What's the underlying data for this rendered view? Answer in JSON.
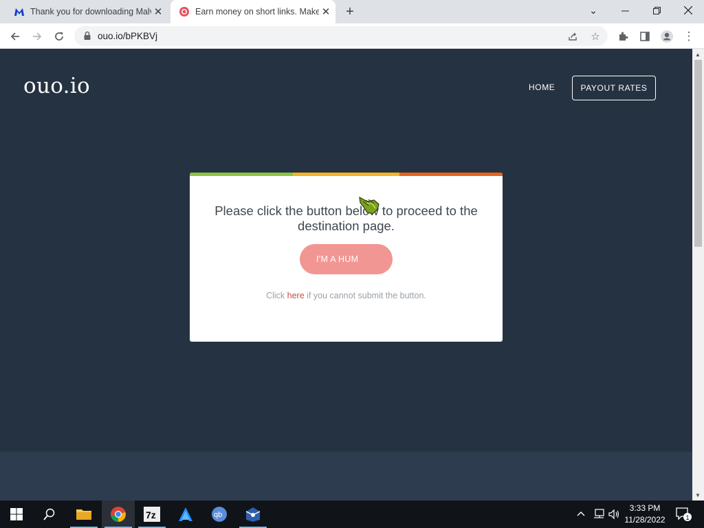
{
  "browser": {
    "tabs": [
      {
        "title": "Thank you for downloading Malv",
        "favicon": "malwarebytes-icon"
      },
      {
        "title": "Earn money on short links. Make",
        "favicon": "ouo-icon",
        "active": true
      }
    ],
    "address": "ouo.io/bPKBVj"
  },
  "site": {
    "logo": "ouo.io",
    "nav": {
      "home": "HOME",
      "payout": "PAYOUT RATES"
    }
  },
  "card": {
    "heading": "Please click the button below to proceed to the destination page.",
    "button": "I'M A HUM",
    "note_before": "Click ",
    "note_link": "here",
    "note_after": " if you cannot submit the button.",
    "bar_colors": [
      "#8dc43f",
      "#f5b325",
      "#e8631c"
    ]
  },
  "taskbar": {
    "apps": [
      "windows-start-icon",
      "search-icon",
      "file-explorer-icon",
      "chrome-icon",
      "7zip-icon",
      "arcade-icon",
      "qbittorrent-icon",
      "installer-icon"
    ],
    "time": "3:33 PM",
    "date": "11/28/2022",
    "notifications": "1"
  }
}
